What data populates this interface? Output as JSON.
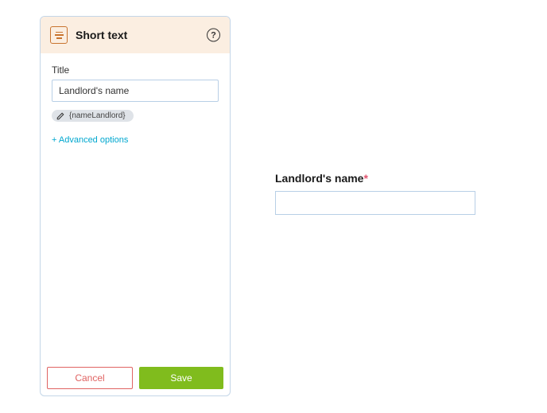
{
  "panel": {
    "header": {
      "title": "Short text"
    },
    "body": {
      "titleLabel": "Title",
      "titleValue": "Landlord's name",
      "chipLabel": "{nameLandlord}",
      "advancedOptionsLabel": "+ Advanced options"
    },
    "footer": {
      "cancelLabel": "Cancel",
      "saveLabel": "Save"
    }
  },
  "preview": {
    "label": "Landlord's name",
    "requiredMark": "*",
    "value": ""
  }
}
